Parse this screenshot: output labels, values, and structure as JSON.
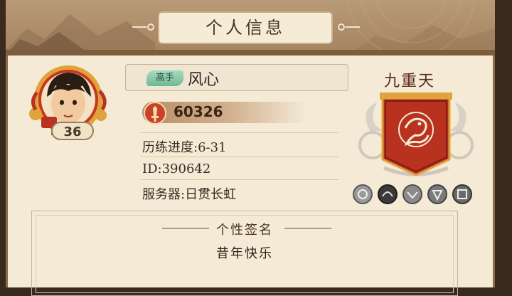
{
  "window": {
    "title": "个人信息"
  },
  "player": {
    "level": "36",
    "rank_tag": "高手",
    "name": "风心",
    "power": "60326"
  },
  "info": {
    "progress": "历练进度:6-31",
    "id": "ID:390642",
    "server": "服务器:日贯长虹"
  },
  "rank": {
    "title": "九重天",
    "tier_icons": [
      "tier-1-icon",
      "tier-2-icon",
      "tier-3-icon",
      "tier-4-icon",
      "tier-5-icon"
    ]
  },
  "signature": {
    "title": "个性签名",
    "text": "昔年快乐"
  },
  "colors": {
    "banner": "#b8321f",
    "accent_gold": "#e0a23a",
    "panel_bg": "#f4ead6"
  }
}
